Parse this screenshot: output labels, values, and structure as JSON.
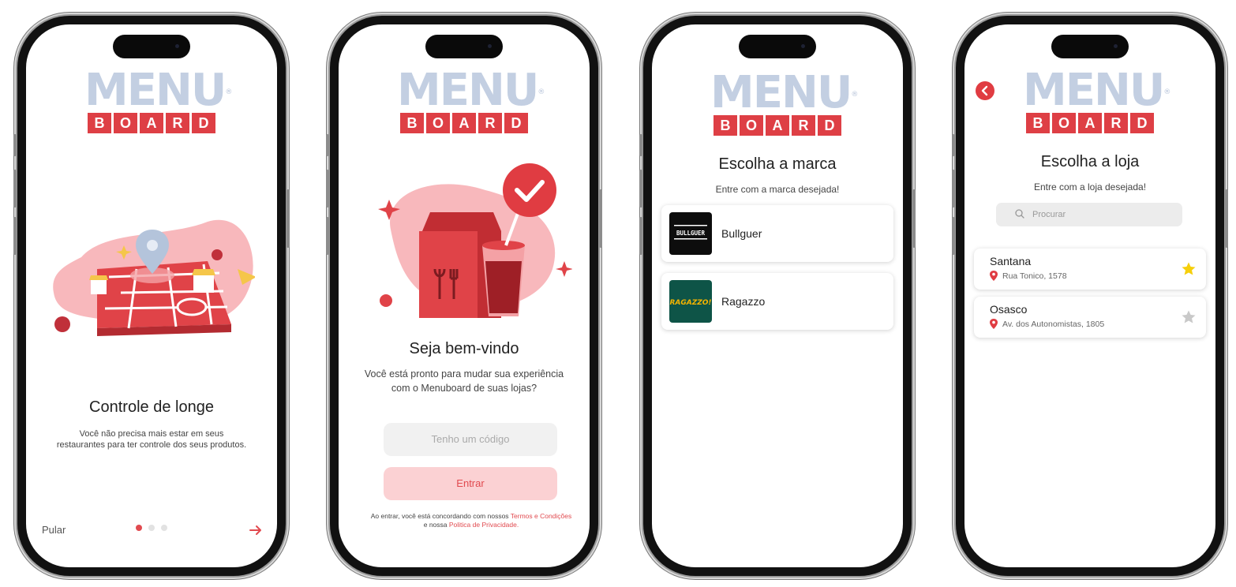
{
  "logo": {
    "word": "MENU",
    "reg": "®",
    "letters": [
      "B",
      "O",
      "A",
      "R",
      "D"
    ]
  },
  "colors": {
    "accent": "#e14a4f",
    "logo_blue": "#c3cfe2",
    "favorite": "#f6cf0b"
  },
  "screen1": {
    "title": "Controle de longe",
    "description": "Você não precisa mais estar em seus restaurantes para ter controle dos seus produtos.",
    "skip_label": "Pular",
    "page_indicator": {
      "count": 3,
      "active": 1
    },
    "next_icon": "arrow-right-icon"
  },
  "screen2": {
    "title": "Seja bem-vindo",
    "description": "Você está pronto para mudar sua experiência com o Menuboard de suas lojas?",
    "code_button": "Tenho um código",
    "enter_button": "Entrar",
    "terms_prefix": "Ao entrar, você está concordando com nossos ",
    "terms_link": "Termos e Condições",
    "terms_mid": " e nossa ",
    "privacy_link": "Politica de Privacidade",
    "terms_end": "."
  },
  "screen3": {
    "title": "Escolha a marca",
    "subtitle": "Entre com a marca desejada!",
    "brands": [
      {
        "name": "Bullguer",
        "logo_text": "BULLGUER"
      },
      {
        "name": "Ragazzo",
        "logo_text": "RAGAZZO!"
      }
    ]
  },
  "screen4": {
    "back_icon": "chevron-left-icon",
    "title": "Escolha a loja",
    "subtitle": "Entre com a loja desejada!",
    "search_placeholder": "Procurar",
    "stores": [
      {
        "name": "Santana",
        "address": "Rua Tonico, 1578",
        "favorite": true
      },
      {
        "name": "Osasco",
        "address": "Av. dos Autonomistas, 1805",
        "favorite": false
      }
    ]
  }
}
